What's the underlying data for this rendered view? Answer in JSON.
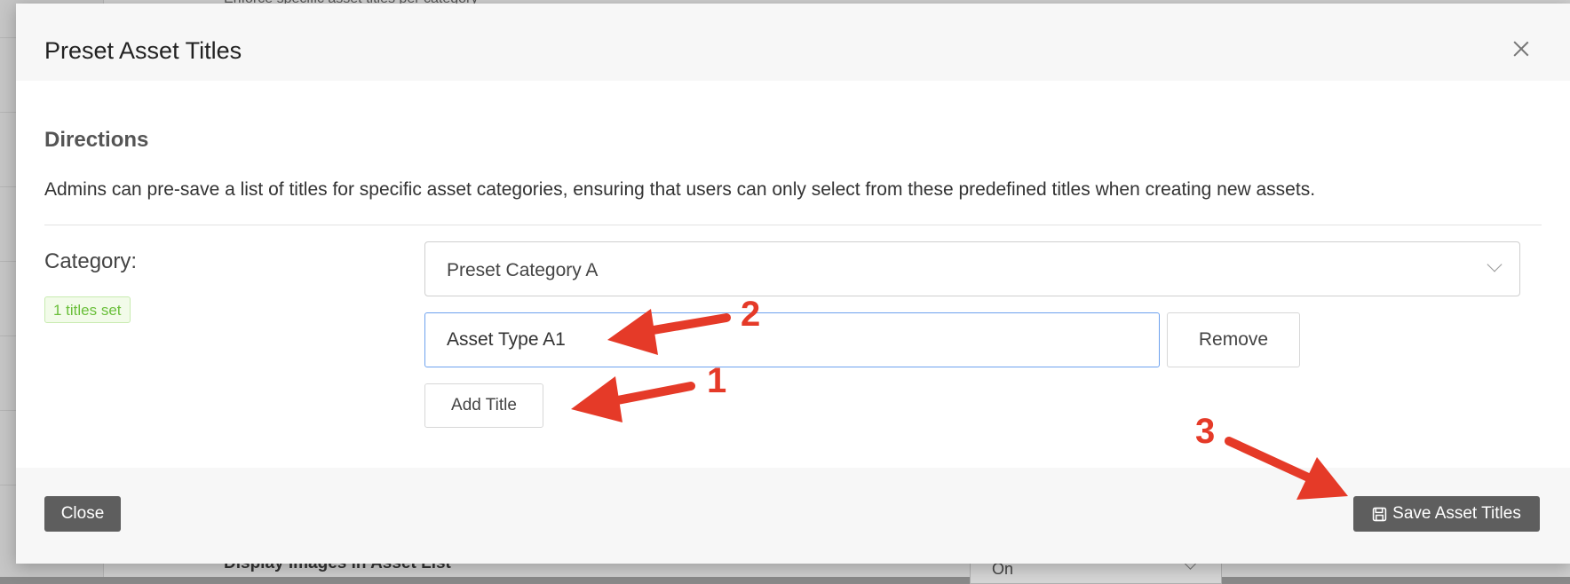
{
  "background": {
    "top_text": "Enforce specific asset titles per category",
    "bottom_label": "Display Images in Asset List",
    "bottom_select_value": "On"
  },
  "modal": {
    "title": "Preset Asset Titles",
    "close_icon": "close-icon",
    "directions_title": "Directions",
    "directions_text": "Admins can pre-save a list of titles for specific asset categories, ensuring that users can only select from these predefined titles when creating new assets.",
    "category_label": "Category:",
    "titles_badge": "1 titles set",
    "category_select": {
      "value": "Preset Category A",
      "icon": "chevron-down-icon"
    },
    "title_input": {
      "value": "Asset Type A1"
    },
    "remove_label": "Remove",
    "add_title_label": "Add Title",
    "footer": {
      "close_label": "Close",
      "save_label": "Save Asset Titles",
      "save_icon": "floppy-disk-icon"
    }
  },
  "annotations": {
    "color": "#e53a28",
    "labels": [
      "1",
      "2",
      "3"
    ]
  }
}
